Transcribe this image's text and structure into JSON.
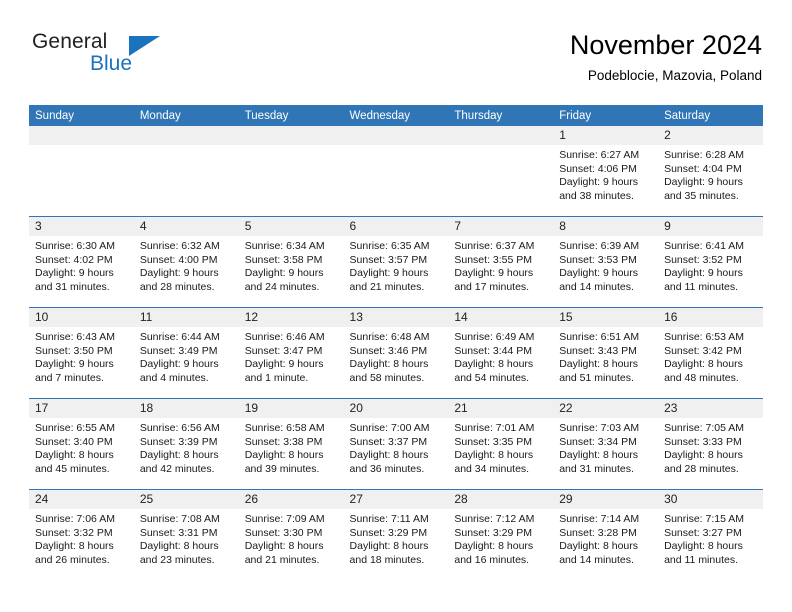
{
  "brand": {
    "name_top": "General",
    "name_bottom": "Blue",
    "accent_color": "#1b72bd",
    "triangle_icon": "blue-triangle-icon"
  },
  "header": {
    "title": "November 2024",
    "subtitle": "Podeblocie, Mazovia, Poland"
  },
  "colors": {
    "header_bar": "#3075b5",
    "day_band": "#f0f0f0",
    "row_divider": "#3075b5",
    "brand_blue": "#1b72bd"
  },
  "weekdays": [
    "Sunday",
    "Monday",
    "Tuesday",
    "Wednesday",
    "Thursday",
    "Friday",
    "Saturday"
  ],
  "weeks": [
    [
      {
        "day": "",
        "empty": true
      },
      {
        "day": "",
        "empty": true
      },
      {
        "day": "",
        "empty": true
      },
      {
        "day": "",
        "empty": true
      },
      {
        "day": "",
        "empty": true
      },
      {
        "day": "1",
        "sunrise": "Sunrise: 6:27 AM",
        "sunset": "Sunset: 4:06 PM",
        "daylight1": "Daylight: 9 hours",
        "daylight2": "and 38 minutes."
      },
      {
        "day": "2",
        "sunrise": "Sunrise: 6:28 AM",
        "sunset": "Sunset: 4:04 PM",
        "daylight1": "Daylight: 9 hours",
        "daylight2": "and 35 minutes."
      }
    ],
    [
      {
        "day": "3",
        "sunrise": "Sunrise: 6:30 AM",
        "sunset": "Sunset: 4:02 PM",
        "daylight1": "Daylight: 9 hours",
        "daylight2": "and 31 minutes."
      },
      {
        "day": "4",
        "sunrise": "Sunrise: 6:32 AM",
        "sunset": "Sunset: 4:00 PM",
        "daylight1": "Daylight: 9 hours",
        "daylight2": "and 28 minutes."
      },
      {
        "day": "5",
        "sunrise": "Sunrise: 6:34 AM",
        "sunset": "Sunset: 3:58 PM",
        "daylight1": "Daylight: 9 hours",
        "daylight2": "and 24 minutes."
      },
      {
        "day": "6",
        "sunrise": "Sunrise: 6:35 AM",
        "sunset": "Sunset: 3:57 PM",
        "daylight1": "Daylight: 9 hours",
        "daylight2": "and 21 minutes."
      },
      {
        "day": "7",
        "sunrise": "Sunrise: 6:37 AM",
        "sunset": "Sunset: 3:55 PM",
        "daylight1": "Daylight: 9 hours",
        "daylight2": "and 17 minutes."
      },
      {
        "day": "8",
        "sunrise": "Sunrise: 6:39 AM",
        "sunset": "Sunset: 3:53 PM",
        "daylight1": "Daylight: 9 hours",
        "daylight2": "and 14 minutes."
      },
      {
        "day": "9",
        "sunrise": "Sunrise: 6:41 AM",
        "sunset": "Sunset: 3:52 PM",
        "daylight1": "Daylight: 9 hours",
        "daylight2": "and 11 minutes."
      }
    ],
    [
      {
        "day": "10",
        "sunrise": "Sunrise: 6:43 AM",
        "sunset": "Sunset: 3:50 PM",
        "daylight1": "Daylight: 9 hours",
        "daylight2": "and 7 minutes."
      },
      {
        "day": "11",
        "sunrise": "Sunrise: 6:44 AM",
        "sunset": "Sunset: 3:49 PM",
        "daylight1": "Daylight: 9 hours",
        "daylight2": "and 4 minutes."
      },
      {
        "day": "12",
        "sunrise": "Sunrise: 6:46 AM",
        "sunset": "Sunset: 3:47 PM",
        "daylight1": "Daylight: 9 hours",
        "daylight2": "and 1 minute."
      },
      {
        "day": "13",
        "sunrise": "Sunrise: 6:48 AM",
        "sunset": "Sunset: 3:46 PM",
        "daylight1": "Daylight: 8 hours",
        "daylight2": "and 58 minutes."
      },
      {
        "day": "14",
        "sunrise": "Sunrise: 6:49 AM",
        "sunset": "Sunset: 3:44 PM",
        "daylight1": "Daylight: 8 hours",
        "daylight2": "and 54 minutes."
      },
      {
        "day": "15",
        "sunrise": "Sunrise: 6:51 AM",
        "sunset": "Sunset: 3:43 PM",
        "daylight1": "Daylight: 8 hours",
        "daylight2": "and 51 minutes."
      },
      {
        "day": "16",
        "sunrise": "Sunrise: 6:53 AM",
        "sunset": "Sunset: 3:42 PM",
        "daylight1": "Daylight: 8 hours",
        "daylight2": "and 48 minutes."
      }
    ],
    [
      {
        "day": "17",
        "sunrise": "Sunrise: 6:55 AM",
        "sunset": "Sunset: 3:40 PM",
        "daylight1": "Daylight: 8 hours",
        "daylight2": "and 45 minutes."
      },
      {
        "day": "18",
        "sunrise": "Sunrise: 6:56 AM",
        "sunset": "Sunset: 3:39 PM",
        "daylight1": "Daylight: 8 hours",
        "daylight2": "and 42 minutes."
      },
      {
        "day": "19",
        "sunrise": "Sunrise: 6:58 AM",
        "sunset": "Sunset: 3:38 PM",
        "daylight1": "Daylight: 8 hours",
        "daylight2": "and 39 minutes."
      },
      {
        "day": "20",
        "sunrise": "Sunrise: 7:00 AM",
        "sunset": "Sunset: 3:37 PM",
        "daylight1": "Daylight: 8 hours",
        "daylight2": "and 36 minutes."
      },
      {
        "day": "21",
        "sunrise": "Sunrise: 7:01 AM",
        "sunset": "Sunset: 3:35 PM",
        "daylight1": "Daylight: 8 hours",
        "daylight2": "and 34 minutes."
      },
      {
        "day": "22",
        "sunrise": "Sunrise: 7:03 AM",
        "sunset": "Sunset: 3:34 PM",
        "daylight1": "Daylight: 8 hours",
        "daylight2": "and 31 minutes."
      },
      {
        "day": "23",
        "sunrise": "Sunrise: 7:05 AM",
        "sunset": "Sunset: 3:33 PM",
        "daylight1": "Daylight: 8 hours",
        "daylight2": "and 28 minutes."
      }
    ],
    [
      {
        "day": "24",
        "sunrise": "Sunrise: 7:06 AM",
        "sunset": "Sunset: 3:32 PM",
        "daylight1": "Daylight: 8 hours",
        "daylight2": "and 26 minutes."
      },
      {
        "day": "25",
        "sunrise": "Sunrise: 7:08 AM",
        "sunset": "Sunset: 3:31 PM",
        "daylight1": "Daylight: 8 hours",
        "daylight2": "and 23 minutes."
      },
      {
        "day": "26",
        "sunrise": "Sunrise: 7:09 AM",
        "sunset": "Sunset: 3:30 PM",
        "daylight1": "Daylight: 8 hours",
        "daylight2": "and 21 minutes."
      },
      {
        "day": "27",
        "sunrise": "Sunrise: 7:11 AM",
        "sunset": "Sunset: 3:29 PM",
        "daylight1": "Daylight: 8 hours",
        "daylight2": "and 18 minutes."
      },
      {
        "day": "28",
        "sunrise": "Sunrise: 7:12 AM",
        "sunset": "Sunset: 3:29 PM",
        "daylight1": "Daylight: 8 hours",
        "daylight2": "and 16 minutes."
      },
      {
        "day": "29",
        "sunrise": "Sunrise: 7:14 AM",
        "sunset": "Sunset: 3:28 PM",
        "daylight1": "Daylight: 8 hours",
        "daylight2": "and 14 minutes."
      },
      {
        "day": "30",
        "sunrise": "Sunrise: 7:15 AM",
        "sunset": "Sunset: 3:27 PM",
        "daylight1": "Daylight: 8 hours",
        "daylight2": "and 11 minutes."
      }
    ]
  ]
}
